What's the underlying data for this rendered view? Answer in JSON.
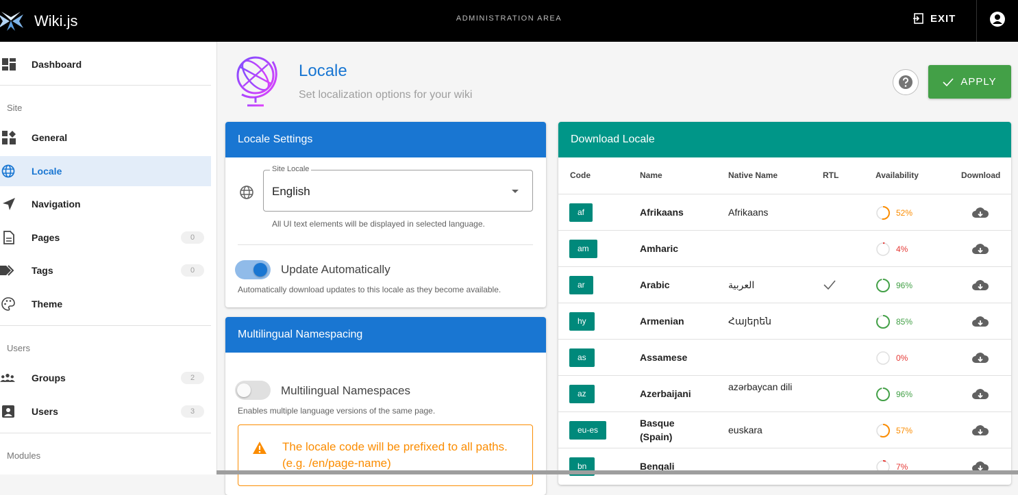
{
  "app": {
    "name": "Wiki.js",
    "admin_title": "ADMINISTRATION AREA",
    "exit_label": "EXIT"
  },
  "sidebar": {
    "dashboard": "Dashboard",
    "site_header": "Site",
    "general": "General",
    "locale": "Locale",
    "navigation": "Navigation",
    "pages": "Pages",
    "pages_count": "0",
    "tags": "Tags",
    "tags_count": "0",
    "theme": "Theme",
    "users_header": "Users",
    "groups": "Groups",
    "groups_count": "2",
    "users": "Users",
    "users_count": "3",
    "modules_header": "Modules"
  },
  "page": {
    "title": "Locale",
    "subtitle": "Set localization options for your wiki",
    "apply_label": "APPLY"
  },
  "locale_settings": {
    "header": "Locale Settings",
    "field_label": "Site Locale",
    "field_value": "English",
    "field_hint": "All UI text elements will be displayed in selected language.",
    "auto_update_label": "Update Automatically",
    "auto_update_on": true,
    "auto_update_hint": "Automatically download updates to this locale as they become available."
  },
  "namespacing": {
    "header": "Multilingual Namespacing",
    "toggle_label": "Multilingual Namespaces",
    "toggle_on": false,
    "toggle_hint": "Enables multiple language versions of the same page.",
    "alert_text": "The locale code will be prefixed to all paths. (e.g. /en/page-name)"
  },
  "download": {
    "header": "Download Locale",
    "columns": {
      "code": "Code",
      "name": "Name",
      "native": "Native Name",
      "rtl": "RTL",
      "availability": "Availability",
      "download": "Download"
    },
    "rows": [
      {
        "code": "af",
        "name": "Afrikaans",
        "native": "Afrikaans",
        "rtl": false,
        "availability": "52%",
        "pct": 52
      },
      {
        "code": "am",
        "name": "Amharic",
        "native": "",
        "rtl": false,
        "availability": "4%",
        "pct": 4
      },
      {
        "code": "ar",
        "name": "Arabic",
        "native": "العربية",
        "rtl": true,
        "availability": "96%",
        "pct": 96
      },
      {
        "code": "hy",
        "name": "Armenian",
        "native": "Հայերեն",
        "rtl": false,
        "availability": "85%",
        "pct": 85
      },
      {
        "code": "as",
        "name": "Assamese",
        "native": "",
        "rtl": false,
        "availability": "0%",
        "pct": 0
      },
      {
        "code": "az",
        "name": "Azerbaijani",
        "native": "azərbaycan dili",
        "rtl": false,
        "availability": "96%",
        "pct": 96
      },
      {
        "code": "eu-es",
        "name": "Basque (Spain)",
        "native": "euskara",
        "rtl": false,
        "availability": "57%",
        "pct": 57
      },
      {
        "code": "bn",
        "name": "Bengali",
        "native": "",
        "rtl": false,
        "availability": "7%",
        "pct": 7
      }
    ]
  },
  "colors": {
    "primary": "#1976d2",
    "teal": "#00897b",
    "apply": "#43a047",
    "warning": "#fb8c00",
    "good": "#43a047",
    "bad": "#e53935"
  }
}
